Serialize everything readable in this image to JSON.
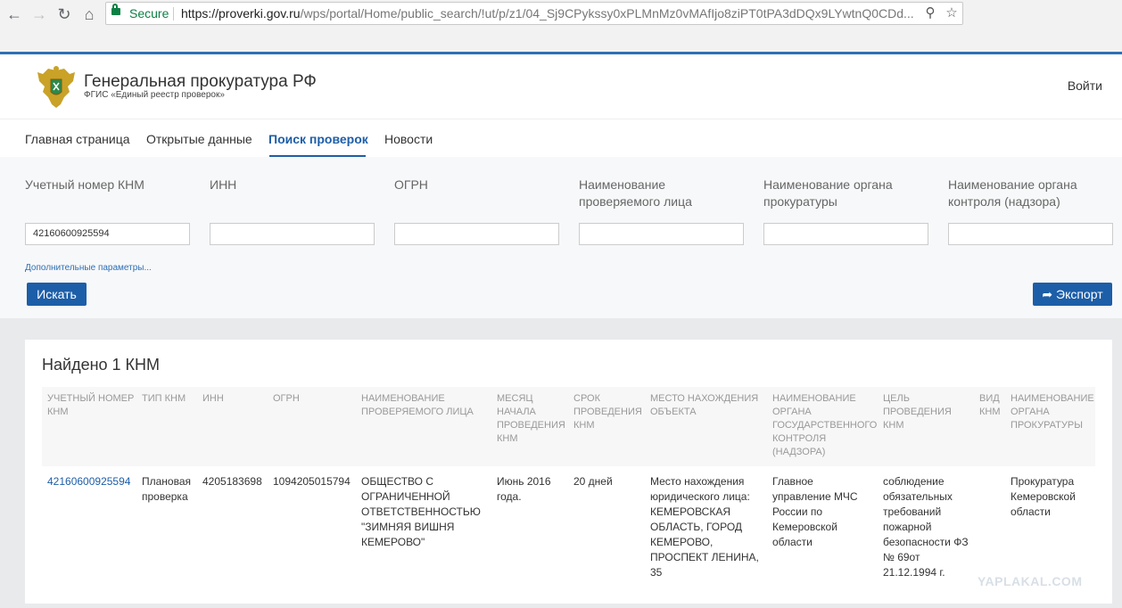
{
  "browser": {
    "secure_label": "Secure",
    "url_host": "https://proverki.gov.ru",
    "url_path": "/wps/portal/Home/public_search/!ut/p/z1/04_Sj9CPykssy0xPLMnMz0vMAfIjo8ziPT0tPA3dDQx9LYwtnQ0CDd..."
  },
  "header": {
    "title": "Генеральная прокуратура РФ",
    "subtitle": "ФГИС «Единый реестр проверок»",
    "login": "Войти"
  },
  "nav": {
    "tabs": [
      "Главная страница",
      "Открытые данные",
      "Поиск проверок",
      "Новости"
    ]
  },
  "search": {
    "labels": [
      "Учетный номер КНМ",
      "ИНН",
      "ОГРН",
      "Наименование проверяемого лица",
      "Наименование органа прокуратуры",
      "Наименование органа контроля (надзора)"
    ],
    "knm_value": "42160600925594",
    "advanced_link": "Дополнительные параметры...",
    "search_button": "Искать",
    "export_button": "Экспорт"
  },
  "results": {
    "found": "Найдено 1 КНМ",
    "columns": [
      "УЧЕТНЫЙ НОМЕР КНМ",
      "ТИП КНМ",
      "ИНН",
      "ОГРН",
      "НАИМЕНОВАНИЕ ПРОВЕРЯЕМОГО ЛИЦА",
      "МЕСЯЦ НАЧАЛА ПРОВЕДЕНИЯ КНМ",
      "СРОК ПРОВЕДЕНИЯ КНМ",
      "МЕСТО НАХОЖДЕНИЯ ОБЪЕКТА",
      "НАИМЕНОВАНИЕ ОРГАНА ГОСУДАРСТВЕННОГО КОНТРОЛЯ (НАДЗОРА)",
      "ЦЕЛЬ ПРОВЕДЕНИЯ КНМ",
      "ВИД КНМ",
      "НАИМЕНОВАНИЕ ОРГАНА ПРОКУРАТУРЫ"
    ],
    "row": {
      "knm": "42160600925594",
      "type": "Плановая проверка",
      "inn": "4205183698",
      "ogrn": "1094205015794",
      "name": "ОБЩЕСТВО С ОГРАНИЧЕННОЙ ОТВЕТСТВЕННОСТЬЮ \"ЗИМНЯЯ ВИШНЯ КЕМЕРОВО\"",
      "month": "Июнь 2016 года.",
      "duration": "20 дней",
      "location": "Место нахождения юридического лица: КЕМЕРОВСКАЯ ОБЛАСТЬ, ГОРОД КЕМЕРОВО, ПРОСПЕКТ ЛЕНИНА, 35",
      "control_body": "Главное управление МЧС России по Кемеровской области",
      "purpose": "соблюдение обязательных требований пожарной безопасности ФЗ № 69от 21.12.1994 г.",
      "kind": "",
      "prosecutor": "Прокуратура Кемеровской области"
    }
  },
  "watermark": "YAPLAKAL.COM"
}
